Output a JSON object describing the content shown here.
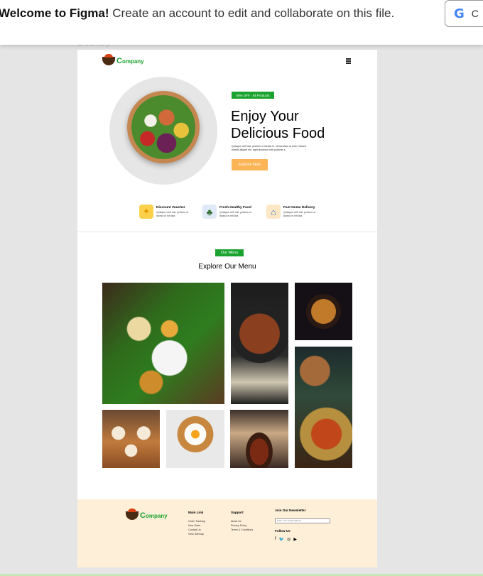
{
  "banner": {
    "welcome_bold": "Welcome to Figma!",
    "message": "Create an account to edit and collaborate on this file.",
    "google_button_text": "C",
    "google_glyph": "G"
  },
  "canvas": {
    "frame_label": "Desktop ▾"
  },
  "site": {
    "brand": {
      "initial": "C",
      "rest": "ompany"
    },
    "hero": {
      "badge": "50% OFF · All Products",
      "title_line1": "Enjoy Your",
      "title_line2": "Delicious Food",
      "description": "Quisque velit nisi, pretium ut lacinia in, elementum id enim. Mauris blandit aliquet elit, eget tincidunt nibh pulvinar a.",
      "cta": "Explore Now"
    },
    "features": [
      {
        "title": "Discount Voucher",
        "desc": "Quisque velit nisi, pretium ut lacinia in elit fact",
        "icon": "voucher-icon"
      },
      {
        "title": "Fresh Healthy Food",
        "desc": "Quisque velit nisi, pretium ut lacinia in elit fact",
        "icon": "basket-icon"
      },
      {
        "title": "Fast Home Delivery",
        "desc": "Quisque velit nisi, pretium ut lacinia in elit fact",
        "icon": "house-icon"
      }
    ],
    "menu": {
      "badge": "Our Menu",
      "title": "Explore Our Menu"
    },
    "footer": {
      "main_link": {
        "heading": "Main Link",
        "items": [
          "Order Tracking",
          "New Order",
          "Contact Us",
          "View Sitemap"
        ]
      },
      "support": {
        "heading": "Support",
        "items": [
          "About Us",
          "Privacy Policy",
          "Terms & Conditions"
        ]
      },
      "newsletter": {
        "heading": "Join Our Newsletter",
        "placeholder": "Enter Your Email address...",
        "follow": "Follow Us"
      },
      "socials": [
        "f",
        "🐦",
        "◎",
        "▶"
      ]
    }
  },
  "colors": {
    "green": "#1ba32f",
    "orange": "#fbb456",
    "footer_bg": "#feefd8"
  }
}
